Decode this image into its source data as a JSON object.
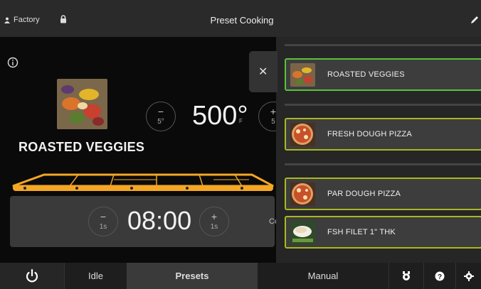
{
  "header": {
    "user_label": "Factory",
    "title": "Preset Cooking"
  },
  "main": {
    "preset_name": "ROASTED VEGGIES",
    "temperature": {
      "value": "500°",
      "unit": "F",
      "step_label": "5°",
      "step_label_plus": "5"
    },
    "timer": {
      "value": "08:00",
      "step_label": "1s",
      "cook_label": "Co"
    }
  },
  "preset_list": {
    "items": [
      {
        "label": "ROASTED VEGGIES",
        "selected": true
      },
      {
        "label": "FRESH DOUGH PIZZA",
        "selected": false
      },
      {
        "label": "PAR DOUGH PIZZA",
        "selected": false
      },
      {
        "label": "FSH FILET 1\" THK",
        "selected": false
      }
    ]
  },
  "nav": {
    "idle_label": "Idle",
    "presets_label": "Presets",
    "manual_label": "Manual"
  },
  "colors": {
    "accent_orange": "#f5a623",
    "selected_border": "#58c23a",
    "item_border": "#aab81e"
  },
  "icons": [
    "user-icon",
    "lock-icon",
    "pencil-icon",
    "info-icon",
    "close-icon",
    "power-icon",
    "cleaning-icon",
    "help-icon",
    "settings-icon"
  ]
}
